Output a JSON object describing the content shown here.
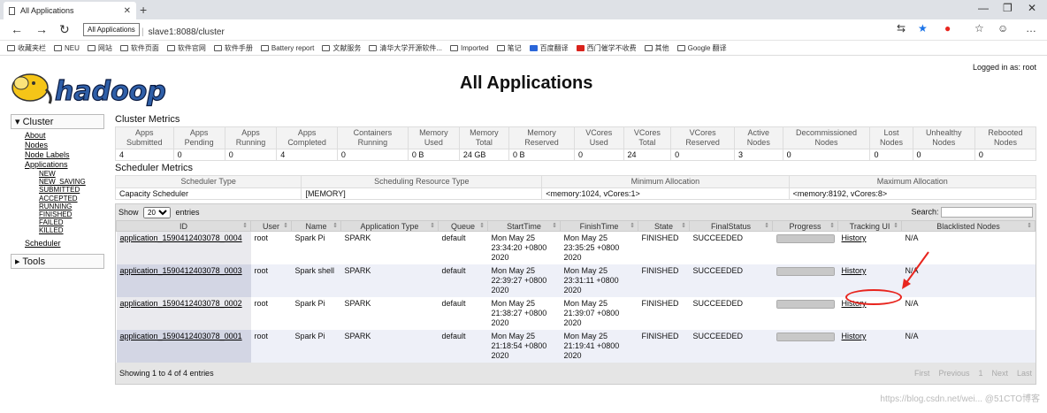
{
  "browser": {
    "tab_title": "All Applications",
    "tooltip": "All Applications",
    "url_secure_tail": "全",
    "url": "slave1:8088/cluster",
    "bookmarks": [
      "收藏夹栏",
      "NEU",
      "网站",
      "软件页面",
      "软件官网",
      "软件手册",
      "Battery report",
      "文献服务",
      "清华大学开源软件...",
      "Imported",
      "笔记",
      "百度翻译",
      "西门催学不收费",
      "其他",
      "Google 翻译"
    ]
  },
  "page": {
    "title": "All Applications",
    "logged_in": "Logged in as: root",
    "logo_text": "hadoop"
  },
  "sidebar": {
    "cluster_label": "Cluster",
    "cluster_links": [
      "About",
      "Nodes",
      "Node Labels",
      "Applications"
    ],
    "app_states": [
      "NEW",
      "NEW_SAVING",
      "SUBMITTED",
      "ACCEPTED",
      "RUNNING",
      "FINISHED",
      "FAILED",
      "KILLED"
    ],
    "scheduler_link": "Scheduler",
    "tools_label": "Tools"
  },
  "cluster_metrics": {
    "title": "Cluster Metrics",
    "headers": [
      "Apps Submitted",
      "Apps Pending",
      "Apps Running",
      "Apps Completed",
      "Containers Running",
      "Memory Used",
      "Memory Total",
      "Memory Reserved",
      "VCores Used",
      "VCores Total",
      "VCores Reserved",
      "Active Nodes",
      "Decommissioned Nodes",
      "Lost Nodes",
      "Unhealthy Nodes",
      "Rebooted Nodes"
    ],
    "values": [
      "4",
      "0",
      "0",
      "4",
      "0",
      "0 B",
      "24 GB",
      "0 B",
      "0",
      "24",
      "0",
      "3",
      "0",
      "0",
      "0",
      "0"
    ]
  },
  "scheduler_metrics": {
    "title": "Scheduler Metrics",
    "headers": [
      "Scheduler Type",
      "Scheduling Resource Type",
      "Minimum Allocation",
      "Maximum Allocation"
    ],
    "values": [
      "Capacity Scheduler",
      "[MEMORY]",
      "<memory:1024, vCores:1>",
      "<memory:8192, vCores:8>"
    ]
  },
  "apps_table": {
    "show_label": "Show",
    "page_size": "20",
    "entries_label": "entries",
    "search_label": "Search:",
    "headers": [
      "ID",
      "User",
      "Name",
      "Application Type",
      "Queue",
      "StartTime",
      "FinishTime",
      "State",
      "FinalStatus",
      "Progress",
      "Tracking UI",
      "Blacklisted Nodes"
    ],
    "rows": [
      {
        "id": "application_1590412403078_0004",
        "user": "root",
        "name": "Spark Pi",
        "type": "SPARK",
        "queue": "default",
        "start": "Mon May 25 23:34:20 +0800 2020",
        "finish": "Mon May 25 23:35:25 +0800 2020",
        "state": "FINISHED",
        "final": "SUCCEEDED",
        "progress": 1.0,
        "tracking": "History",
        "blacklisted": "N/A"
      },
      {
        "id": "application_1590412403078_0003",
        "user": "root",
        "name": "Spark shell",
        "type": "SPARK",
        "queue": "default",
        "start": "Mon May 25 22:39:27 +0800 2020",
        "finish": "Mon May 25 23:31:11 +0800 2020",
        "state": "FINISHED",
        "final": "SUCCEEDED",
        "progress": 1.0,
        "tracking": "History",
        "blacklisted": "N/A"
      },
      {
        "id": "application_1590412403078_0002",
        "user": "root",
        "name": "Spark Pi",
        "type": "SPARK",
        "queue": "default",
        "start": "Mon May 25 21:38:27 +0800 2020",
        "finish": "Mon May 25 21:39:07 +0800 2020",
        "state": "FINISHED",
        "final": "SUCCEEDED",
        "progress": 1.0,
        "tracking": "History",
        "blacklisted": "N/A"
      },
      {
        "id": "application_1590412403078_0001",
        "user": "root",
        "name": "Spark Pi",
        "type": "SPARK",
        "queue": "default",
        "start": "Mon May 25 21:18:54 +0800 2020",
        "finish": "Mon May 25 21:19:41 +0800 2020",
        "state": "FINISHED",
        "final": "SUCCEEDED",
        "progress": 1.0,
        "tracking": "History",
        "blacklisted": "N/A"
      }
    ],
    "info": "Showing 1 to 4 of 4 entries",
    "pager": [
      "First",
      "Previous",
      "1",
      "Next",
      "Last"
    ]
  },
  "watermark": "https://blog.csdn.net/wei... @51CTO博客",
  "colors": {
    "annotation": "#e8251e"
  }
}
